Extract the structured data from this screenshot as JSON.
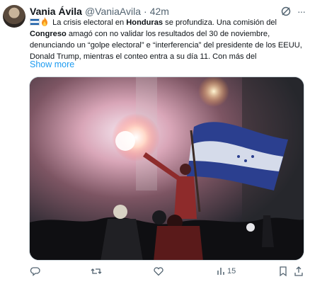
{
  "tweet": {
    "author_name": "Vania Ávila",
    "author_handle": "@VaniaAvila",
    "separator": "·",
    "time": "42m",
    "text_part1": " La crisis electoral en ",
    "text_bold1": "Honduras",
    "text_part2": " se profundiza. Una comisión del ",
    "text_bold2": "Congreso",
    "text_part3": " amagó con no validar los resultados del 30 de noviembre, denunciando un “golpe electoral” e “interferencia” del presidente de los EEUU, Donald Trump, mientras el conteo entra a su día 11. Con más del",
    "show_more": "Show more"
  },
  "actions": {
    "reply_count": "",
    "retweet_count": "",
    "like_count": "",
    "views_count": "15"
  },
  "icons": [
    "grok-icon",
    "more-icon",
    "honduras-flag-icon",
    "fire-icon",
    "reply-icon",
    "retweet-icon",
    "like-icon",
    "views-icon",
    "bookmark-icon",
    "share-icon"
  ],
  "colors": {
    "accent": "#1d9bf0",
    "muted": "#536471",
    "text": "#0f1419"
  }
}
